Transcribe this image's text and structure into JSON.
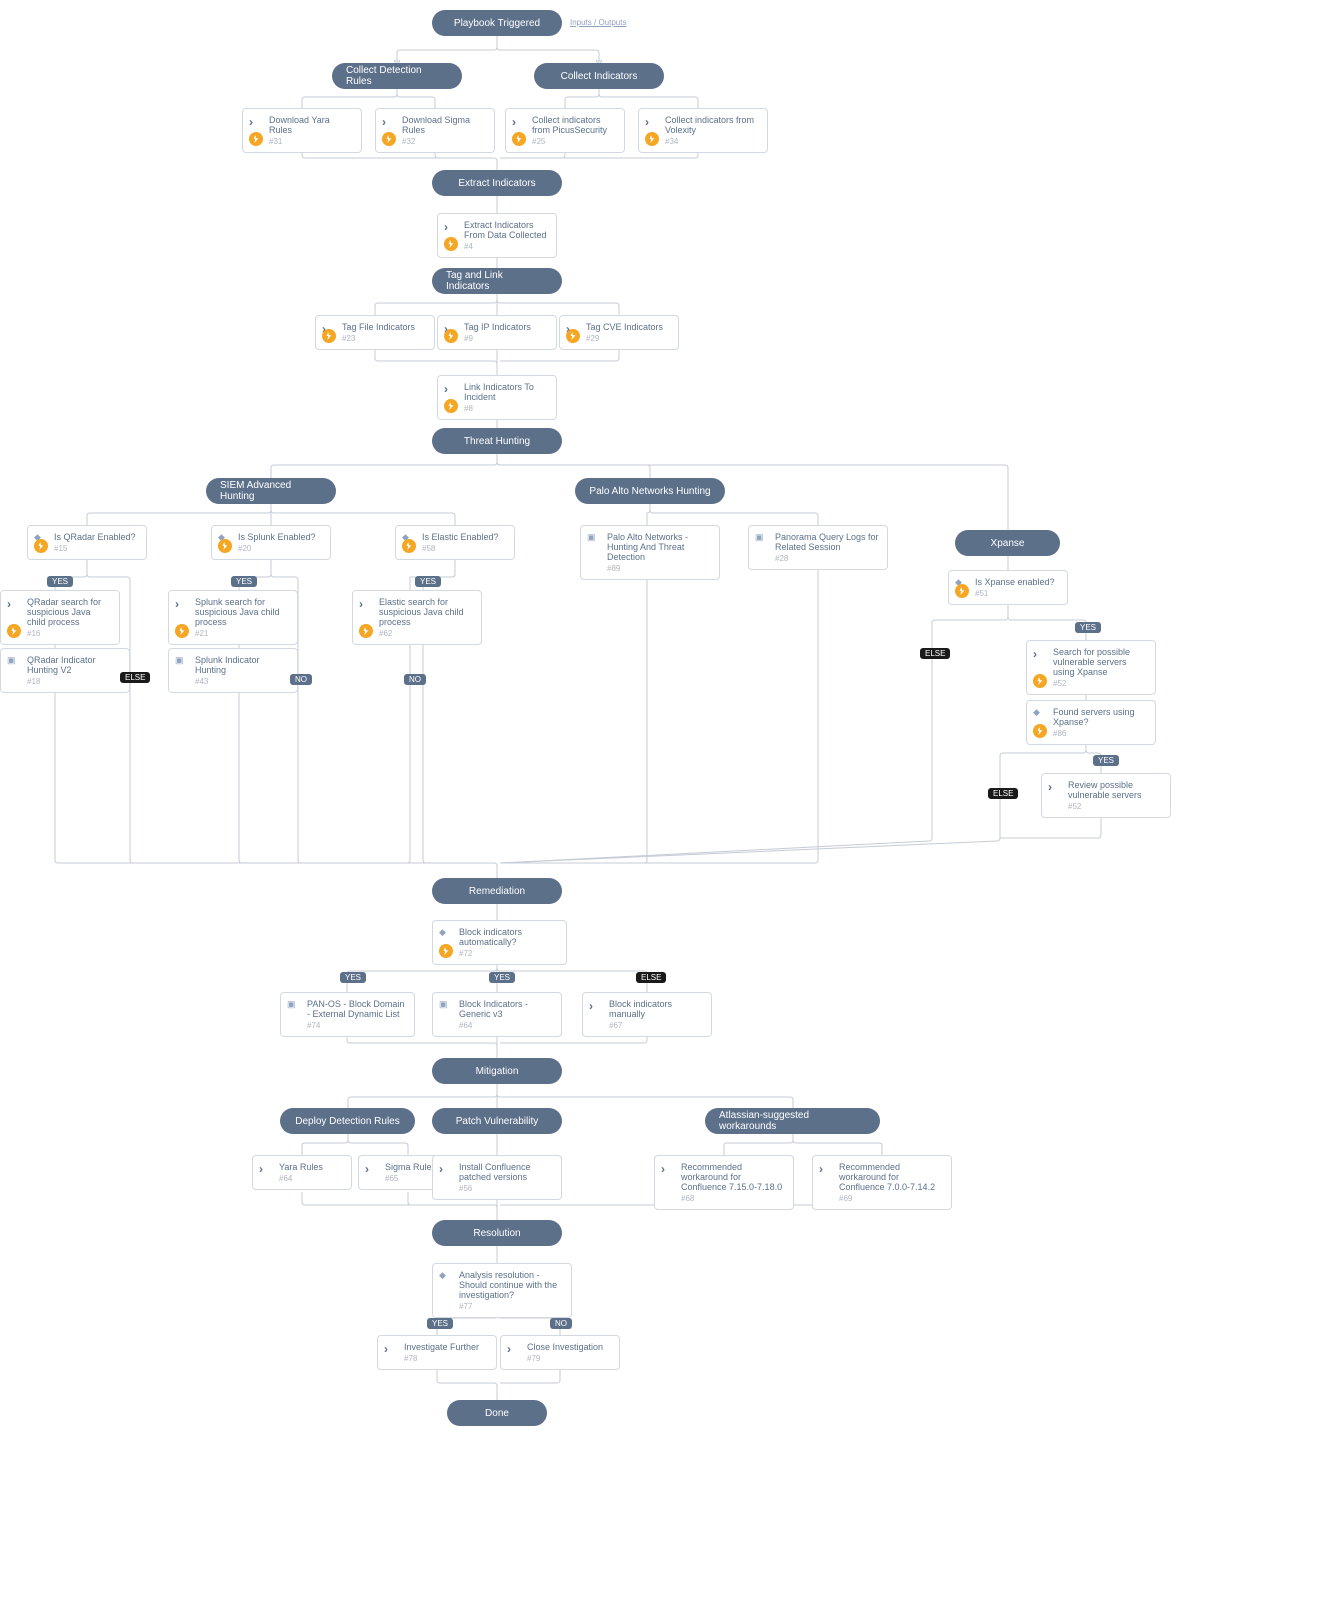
{
  "header": {
    "title": "Playbook Triggered",
    "inputs_link": "Inputs / Outputs"
  },
  "sections": {
    "collect_rules": "Collect Detection Rules",
    "collect_ind": "Collect Indicators",
    "extract": "Extract Indicators",
    "tag": "Tag and Link Indicators",
    "hunt": "Threat Hunting",
    "siem": "SIEM Advanced Hunting",
    "panw": "Palo Alto Networks Hunting",
    "xpanse": "Xpanse",
    "remed": "Remediation",
    "mitig": "Mitigation",
    "deploy_rules": "Deploy Detection Rules",
    "patch": "Patch Vulnerability",
    "atl": "Atlassian-suggested workarounds",
    "res": "Resolution",
    "done": "Done"
  },
  "tasks": {
    "yara": {
      "title": "Download Yara Rules",
      "id": "#31"
    },
    "sigma": {
      "title": "Download Sigma Rules",
      "id": "#32"
    },
    "picus": {
      "title": "Collect indicators from PicusSecurity",
      "id": "#25"
    },
    "volexity": {
      "title": "Collect indicators from Volexity",
      "id": "#34"
    },
    "extract": {
      "title": "Extract Indicators From Data Collected",
      "id": "#4"
    },
    "tag_file": {
      "title": "Tag File Indicators",
      "id": "#23"
    },
    "tag_ip": {
      "title": "Tag IP Indicators",
      "id": "#9"
    },
    "tag_cve": {
      "title": "Tag CVE Indicators",
      "id": "#29"
    },
    "link": {
      "title": "Link Indicators To Incident",
      "id": "#8"
    },
    "panw_hunt": {
      "title": "Palo Alto Networks - Hunting And Threat Detection",
      "id": "#89"
    },
    "panorama": {
      "title": "Panorama Query Logs for Related Session",
      "id": "#28"
    },
    "qradar_search": {
      "title": "QRadar search for suspicious Java child process",
      "id": "#16"
    },
    "splunk_search": {
      "title": "Splunk search for suspicious Java child process",
      "id": "#21"
    },
    "elastic_search": {
      "title": "Elastic search for suspicious Java child process",
      "id": "#62"
    },
    "qradar_hunt": {
      "title": "QRadar Indicator Hunting V2",
      "id": "#18"
    },
    "splunk_hunt": {
      "title": "Splunk Indicator Hunting",
      "id": "#43"
    },
    "xpanse_search": {
      "title": "Search for possible vulnerable servers using Xpanse",
      "id": "#52"
    },
    "review_vuln": {
      "title": "Review possible vulnerable servers",
      "id": "#52"
    },
    "pan_block": {
      "title": "PAN-OS - Block Domain - External Dynamic List",
      "id": "#74"
    },
    "block_generic": {
      "title": "Block Indicators - Generic v3",
      "id": "#64"
    },
    "block_manual": {
      "title": "Block indicators manually",
      "id": "#67"
    },
    "dep_yara": {
      "title": "Yara Rules",
      "id": "#64"
    },
    "dep_sigma": {
      "title": "Sigma Rules",
      "id": "#65"
    },
    "install_patch": {
      "title": "Install Confluence patched versions",
      "id": "#56"
    },
    "wa1": {
      "title": "Recommended workaround for Confluence 7.15.0-7.18.0",
      "id": "#68"
    },
    "wa2": {
      "title": "Recommended workaround for Confluence 7.0.0-7.14.2",
      "id": "#69"
    },
    "investigate": {
      "title": "Investigate Further",
      "id": "#78"
    },
    "close": {
      "title": "Close Investigation",
      "id": "#79"
    }
  },
  "conditions": {
    "qradar": {
      "title": "Is QRadar Enabled?",
      "id": "#15"
    },
    "splunk": {
      "title": "Is Splunk Enabled?",
      "id": "#20"
    },
    "elastic": {
      "title": "Is Elastic Enabled?",
      "id": "#58"
    },
    "xpanse_en": {
      "title": "Is Xpanse enabled?",
      "id": "#51"
    },
    "found_servers": {
      "title": "Found servers using Xpanse?",
      "id": "#86"
    },
    "block_auto": {
      "title": "Block indicators automatically?",
      "id": "#72"
    },
    "analysis": {
      "title": "Analysis resolution - Should continue with the investigation?",
      "id": "#77"
    }
  },
  "badges": {
    "yes": "YES",
    "no": "NO",
    "else": "ELSE"
  }
}
